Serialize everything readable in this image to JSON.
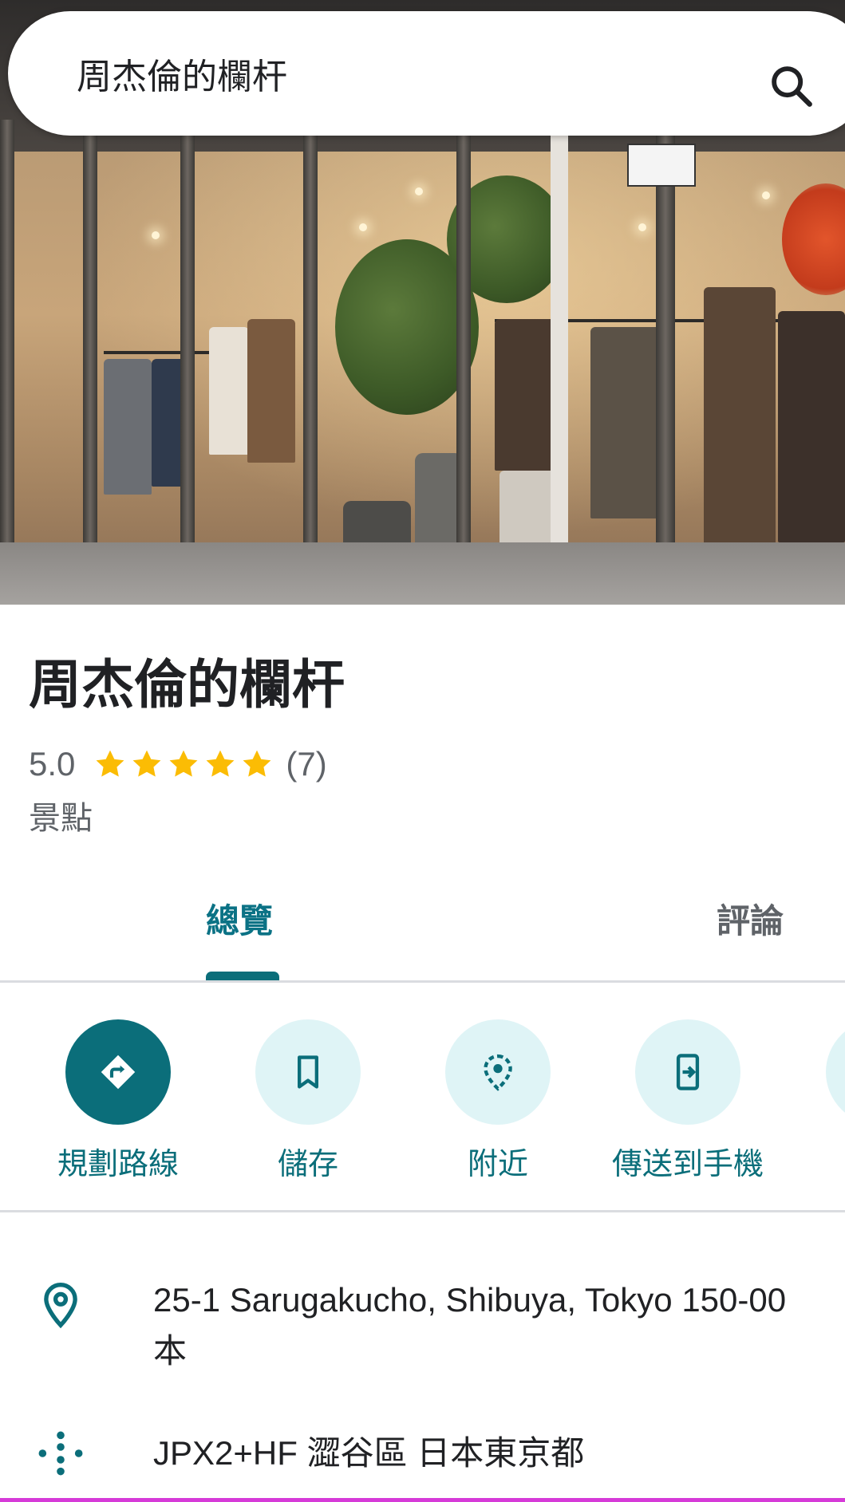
{
  "search": {
    "query": "周杰倫的欄杆"
  },
  "place": {
    "title": "周杰倫的欄杆",
    "rating": "5.0",
    "stars": 5,
    "review_count": "(7)",
    "category": "景點"
  },
  "tabs": [
    {
      "label": "總覽",
      "selected": true
    },
    {
      "label": "評論",
      "selected": false
    }
  ],
  "actions": [
    {
      "label": "規劃路線",
      "icon": "directions-icon"
    },
    {
      "label": "儲存",
      "icon": "bookmark-icon"
    },
    {
      "label": "附近",
      "icon": "nearby-icon"
    },
    {
      "label": "傳送到手機",
      "icon": "send-to-phone-icon"
    }
  ],
  "info": {
    "address_line1": "25-1 Sarugakucho, Shibuya, Tokyo 150-00",
    "address_line2": "本",
    "plus_code": "JPX2+HF 澀谷區 日本東京都"
  },
  "colors": {
    "accent": "#0b6e7a",
    "action_bg": "#dff4f6",
    "star": "#fbbc04",
    "text_secondary": "#5f6368"
  }
}
